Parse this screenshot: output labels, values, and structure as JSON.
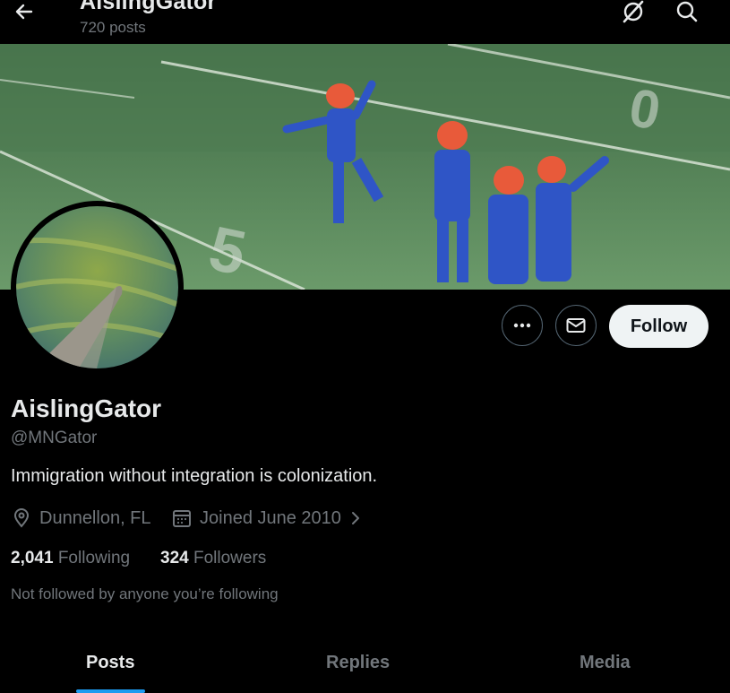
{
  "header": {
    "title": "AislingGator",
    "post_count": "720 posts",
    "back_icon": "arrow-left-icon",
    "grok_icon": "grok-icon",
    "search_icon": "search-icon"
  },
  "banner": {
    "description_icon": "banner-image"
  },
  "profile": {
    "display_name": "AislingGator",
    "handle": "@MNGator",
    "bio": "Immigration without integration is colonization.",
    "location": "Dunnellon, FL",
    "joined": "Joined June 2010",
    "following_count": "2,041",
    "following_label": "Following",
    "followers_count": "324",
    "followers_label": "Followers",
    "not_followed_text": "Not followed by anyone you’re following"
  },
  "actions": {
    "more_icon": "more-icon",
    "message_icon": "envelope-icon",
    "follow_label": "Follow"
  },
  "tabs": [
    {
      "label": "Posts",
      "active": true
    },
    {
      "label": "Replies",
      "active": false
    },
    {
      "label": "Media",
      "active": false
    }
  ],
  "colors": {
    "background": "#000000",
    "text_primary": "#e7e9ea",
    "text_secondary": "#71767b",
    "accent": "#1d9bf0",
    "follow_bg": "#eff3f4"
  }
}
